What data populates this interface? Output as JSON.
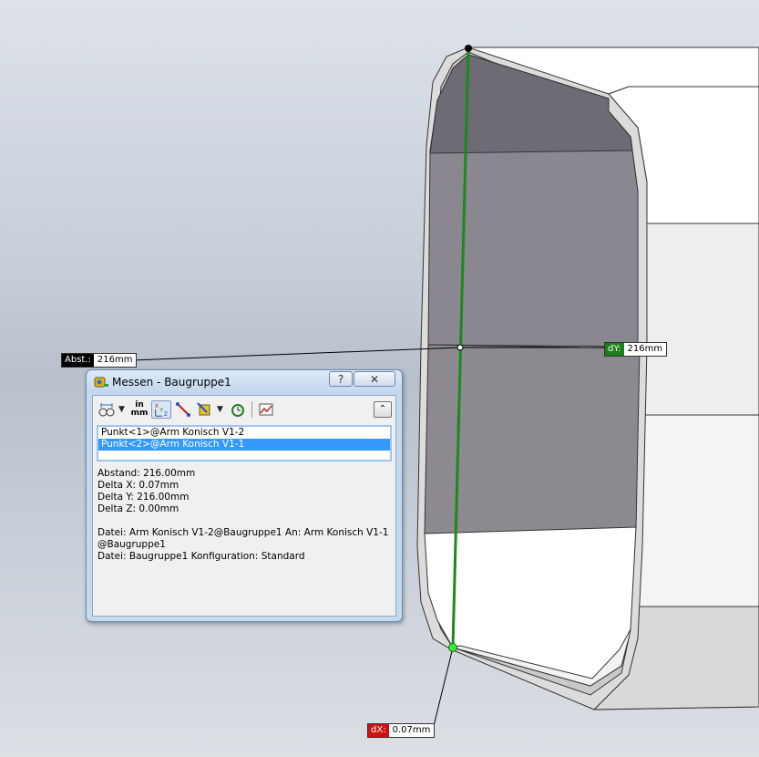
{
  "callouts": {
    "abst": {
      "tag": "Abst.:",
      "value": "216mm"
    },
    "dy": {
      "tag": "dY:",
      "value": "216mm"
    },
    "dx": {
      "tag": "dX:",
      "value": "0.07mm"
    }
  },
  "dialog": {
    "title": "Messen - Baugruppe1",
    "help_label": "?",
    "close_label": "✕",
    "toolbar": {
      "arc_icon": "arc-circle-icon",
      "units_top": "in",
      "units_bottom": "mm",
      "xyz_icon": "xyz-icon",
      "point_icon": "point-to-point-icon",
      "projection_icon": "projection-icon",
      "history_icon": "history-icon",
      "sensor_icon": "sensor-icon",
      "collapse_label": "⌃"
    },
    "selections": [
      "Punkt<1>@Arm Konisch V1-2",
      "Punkt<2>@Arm Konisch V1-1"
    ],
    "results": {
      "abstand": "Abstand: 216.00mm",
      "delta_x": "Delta X: 0.07mm",
      "delta_y": "Delta Y: 216.00mm",
      "delta_z": "Delta Z: 0.00mm",
      "datei1_line1": "Datei: Arm Konisch V1-2@Baugruppe1 An: Arm Konisch V1-1",
      "datei1_line2": "@Baugruppe1",
      "datei2": "Datei: Baugruppe1 Konfiguration: Standard"
    }
  }
}
